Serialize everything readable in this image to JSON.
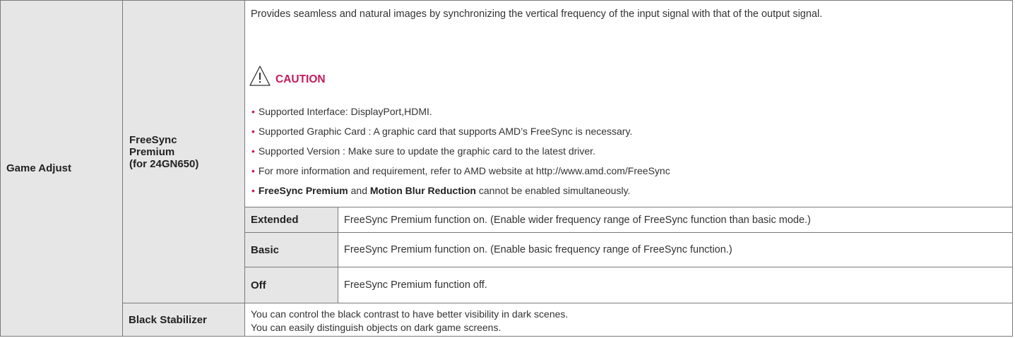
{
  "main_label": "Game Adjust",
  "freesync": {
    "label": "FreeSync\nPremium\n(for 24GN650)",
    "description": "Provides seamless and natural images by synchronizing the vertical frequency of the input signal with that of the output signal.",
    "caution_label": "CAUTION",
    "bullets": [
      "Supported Interface: DisplayPort,HDMI.",
      "Supported Graphic Card : A graphic card that supports AMD’s FreeSync is necessary.",
      "Supported Version : Make sure to update the graphic card to the latest driver.",
      "For more information and requirement, refer to AMD website at http://www.amd.com/FreeSync"
    ],
    "last_bullet": {
      "part1": "FreeSync Premium",
      "part2": " and ",
      "part3": "Motion Blur Reduction",
      "part4": " cannot be enabled simultaneously."
    },
    "options": [
      {
        "name": "Extended",
        "desc": "FreeSync Premium function on. (Enable wider frequency range of FreeSync function than basic mode.)"
      },
      {
        "name": "Basic",
        "desc": "FreeSync Premium function on. (Enable basic frequency range of FreeSync function.)"
      },
      {
        "name": "Off",
        "desc": "FreeSync Premium function off."
      }
    ]
  },
  "black_stabilizer": {
    "label": "Black Stabilizer",
    "desc_line1": "You can control the black contrast to have better visibility in dark scenes.",
    "desc_line2": "You can easily distinguish objects on dark game screens."
  },
  "colors": {
    "accent": "#c3195d",
    "gray_cell": "#e6e6e6",
    "border": "#7a7a7a"
  },
  "icons": {
    "caution": "warning-triangle-icon",
    "bullet": "bullet-dot"
  }
}
